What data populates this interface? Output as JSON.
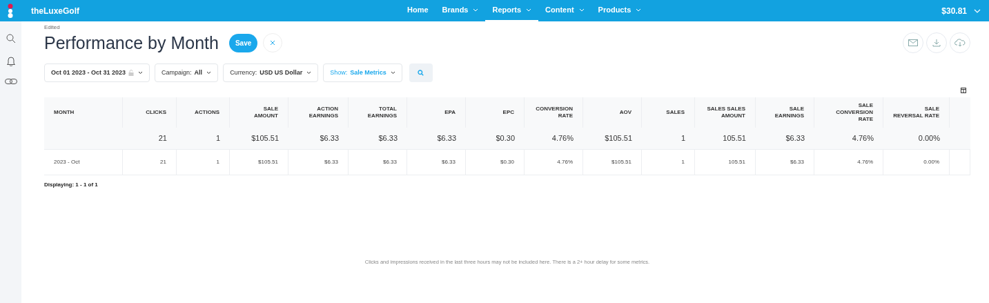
{
  "brand": "theLuxeGolf",
  "nav": [
    {
      "label": "Home",
      "dropdown": false,
      "selected": false
    },
    {
      "label": "Brands",
      "dropdown": true,
      "selected": false
    },
    {
      "label": "Reports",
      "dropdown": true,
      "selected": true
    },
    {
      "label": "Content",
      "dropdown": true,
      "selected": false
    },
    {
      "label": "Products",
      "dropdown": true,
      "selected": false
    }
  ],
  "balance": "$30.81",
  "status_label": "Edited",
  "title": "Performance by Month",
  "save_button": "Save",
  "filters": [
    {
      "kind": "date",
      "label": "Oct 01 2023 - Oct 31 2023"
    },
    {
      "kind": "select",
      "label": "Campaign:",
      "value": "All"
    },
    {
      "kind": "select",
      "label": "Currency:",
      "value": "USD US Dollar"
    },
    {
      "kind": "accent",
      "label": "Show:",
      "value": "Sale Metrics"
    }
  ],
  "table": {
    "columns": [
      "MONTH",
      "CLICKS",
      "ACTIONS",
      "SALE AMOUNT",
      "ACTION EARNINGS",
      "TOTAL EARNINGS",
      "EPA",
      "EPC",
      "CONVERSION RATE",
      "AOV",
      "SALES",
      "SALES SALES AMOUNT",
      "SALE EARNINGS",
      "SALE CONVERSION RATE",
      "SALE REVERSAL RATE"
    ],
    "rows": [
      {
        "kind": "total",
        "actions_link": false,
        "cells": [
          "",
          "21",
          "1",
          "$105.51",
          "$6.33",
          "$6.33",
          "$6.33",
          "$0.30",
          "4.76%",
          "$105.51",
          "1",
          "105.51",
          "$6.33",
          "4.76%",
          "0.00%"
        ]
      },
      {
        "kind": "data",
        "actions_link": true,
        "cells": [
          "2023 - Oct",
          "21",
          "1",
          "$105.51",
          "$6.33",
          "$6.33",
          "$6.33",
          "$0.30",
          "4.76%",
          "$105.51",
          "1",
          "105.51",
          "$6.33",
          "4.76%",
          "0.00%"
        ]
      }
    ]
  },
  "displaying": "Displaying: 1 - 1 of 1",
  "footnote": "Clicks and impressions received in the last three hours may not be included here. There is a 2+ hour delay for some metrics."
}
